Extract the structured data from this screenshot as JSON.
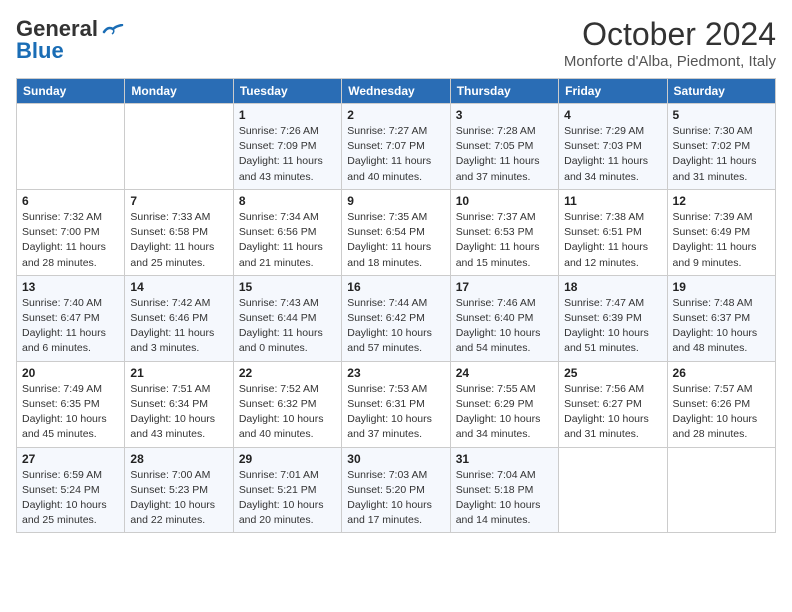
{
  "header": {
    "logo_line1": "General",
    "logo_line2": "Blue",
    "title": "October 2024",
    "subtitle": "Monforte d'Alba, Piedmont, Italy"
  },
  "days_of_week": [
    "Sunday",
    "Monday",
    "Tuesday",
    "Wednesday",
    "Thursday",
    "Friday",
    "Saturday"
  ],
  "weeks": [
    [
      {
        "num": "",
        "info": ""
      },
      {
        "num": "",
        "info": ""
      },
      {
        "num": "1",
        "info": "Sunrise: 7:26 AM\nSunset: 7:09 PM\nDaylight: 11 hours and 43 minutes."
      },
      {
        "num": "2",
        "info": "Sunrise: 7:27 AM\nSunset: 7:07 PM\nDaylight: 11 hours and 40 minutes."
      },
      {
        "num": "3",
        "info": "Sunrise: 7:28 AM\nSunset: 7:05 PM\nDaylight: 11 hours and 37 minutes."
      },
      {
        "num": "4",
        "info": "Sunrise: 7:29 AM\nSunset: 7:03 PM\nDaylight: 11 hours and 34 minutes."
      },
      {
        "num": "5",
        "info": "Sunrise: 7:30 AM\nSunset: 7:02 PM\nDaylight: 11 hours and 31 minutes."
      }
    ],
    [
      {
        "num": "6",
        "info": "Sunrise: 7:32 AM\nSunset: 7:00 PM\nDaylight: 11 hours and 28 minutes."
      },
      {
        "num": "7",
        "info": "Sunrise: 7:33 AM\nSunset: 6:58 PM\nDaylight: 11 hours and 25 minutes."
      },
      {
        "num": "8",
        "info": "Sunrise: 7:34 AM\nSunset: 6:56 PM\nDaylight: 11 hours and 21 minutes."
      },
      {
        "num": "9",
        "info": "Sunrise: 7:35 AM\nSunset: 6:54 PM\nDaylight: 11 hours and 18 minutes."
      },
      {
        "num": "10",
        "info": "Sunrise: 7:37 AM\nSunset: 6:53 PM\nDaylight: 11 hours and 15 minutes."
      },
      {
        "num": "11",
        "info": "Sunrise: 7:38 AM\nSunset: 6:51 PM\nDaylight: 11 hours and 12 minutes."
      },
      {
        "num": "12",
        "info": "Sunrise: 7:39 AM\nSunset: 6:49 PM\nDaylight: 11 hours and 9 minutes."
      }
    ],
    [
      {
        "num": "13",
        "info": "Sunrise: 7:40 AM\nSunset: 6:47 PM\nDaylight: 11 hours and 6 minutes."
      },
      {
        "num": "14",
        "info": "Sunrise: 7:42 AM\nSunset: 6:46 PM\nDaylight: 11 hours and 3 minutes."
      },
      {
        "num": "15",
        "info": "Sunrise: 7:43 AM\nSunset: 6:44 PM\nDaylight: 11 hours and 0 minutes."
      },
      {
        "num": "16",
        "info": "Sunrise: 7:44 AM\nSunset: 6:42 PM\nDaylight: 10 hours and 57 minutes."
      },
      {
        "num": "17",
        "info": "Sunrise: 7:46 AM\nSunset: 6:40 PM\nDaylight: 10 hours and 54 minutes."
      },
      {
        "num": "18",
        "info": "Sunrise: 7:47 AM\nSunset: 6:39 PM\nDaylight: 10 hours and 51 minutes."
      },
      {
        "num": "19",
        "info": "Sunrise: 7:48 AM\nSunset: 6:37 PM\nDaylight: 10 hours and 48 minutes."
      }
    ],
    [
      {
        "num": "20",
        "info": "Sunrise: 7:49 AM\nSunset: 6:35 PM\nDaylight: 10 hours and 45 minutes."
      },
      {
        "num": "21",
        "info": "Sunrise: 7:51 AM\nSunset: 6:34 PM\nDaylight: 10 hours and 43 minutes."
      },
      {
        "num": "22",
        "info": "Sunrise: 7:52 AM\nSunset: 6:32 PM\nDaylight: 10 hours and 40 minutes."
      },
      {
        "num": "23",
        "info": "Sunrise: 7:53 AM\nSunset: 6:31 PM\nDaylight: 10 hours and 37 minutes."
      },
      {
        "num": "24",
        "info": "Sunrise: 7:55 AM\nSunset: 6:29 PM\nDaylight: 10 hours and 34 minutes."
      },
      {
        "num": "25",
        "info": "Sunrise: 7:56 AM\nSunset: 6:27 PM\nDaylight: 10 hours and 31 minutes."
      },
      {
        "num": "26",
        "info": "Sunrise: 7:57 AM\nSunset: 6:26 PM\nDaylight: 10 hours and 28 minutes."
      }
    ],
    [
      {
        "num": "27",
        "info": "Sunrise: 6:59 AM\nSunset: 5:24 PM\nDaylight: 10 hours and 25 minutes."
      },
      {
        "num": "28",
        "info": "Sunrise: 7:00 AM\nSunset: 5:23 PM\nDaylight: 10 hours and 22 minutes."
      },
      {
        "num": "29",
        "info": "Sunrise: 7:01 AM\nSunset: 5:21 PM\nDaylight: 10 hours and 20 minutes."
      },
      {
        "num": "30",
        "info": "Sunrise: 7:03 AM\nSunset: 5:20 PM\nDaylight: 10 hours and 17 minutes."
      },
      {
        "num": "31",
        "info": "Sunrise: 7:04 AM\nSunset: 5:18 PM\nDaylight: 10 hours and 14 minutes."
      },
      {
        "num": "",
        "info": ""
      },
      {
        "num": "",
        "info": ""
      }
    ]
  ]
}
